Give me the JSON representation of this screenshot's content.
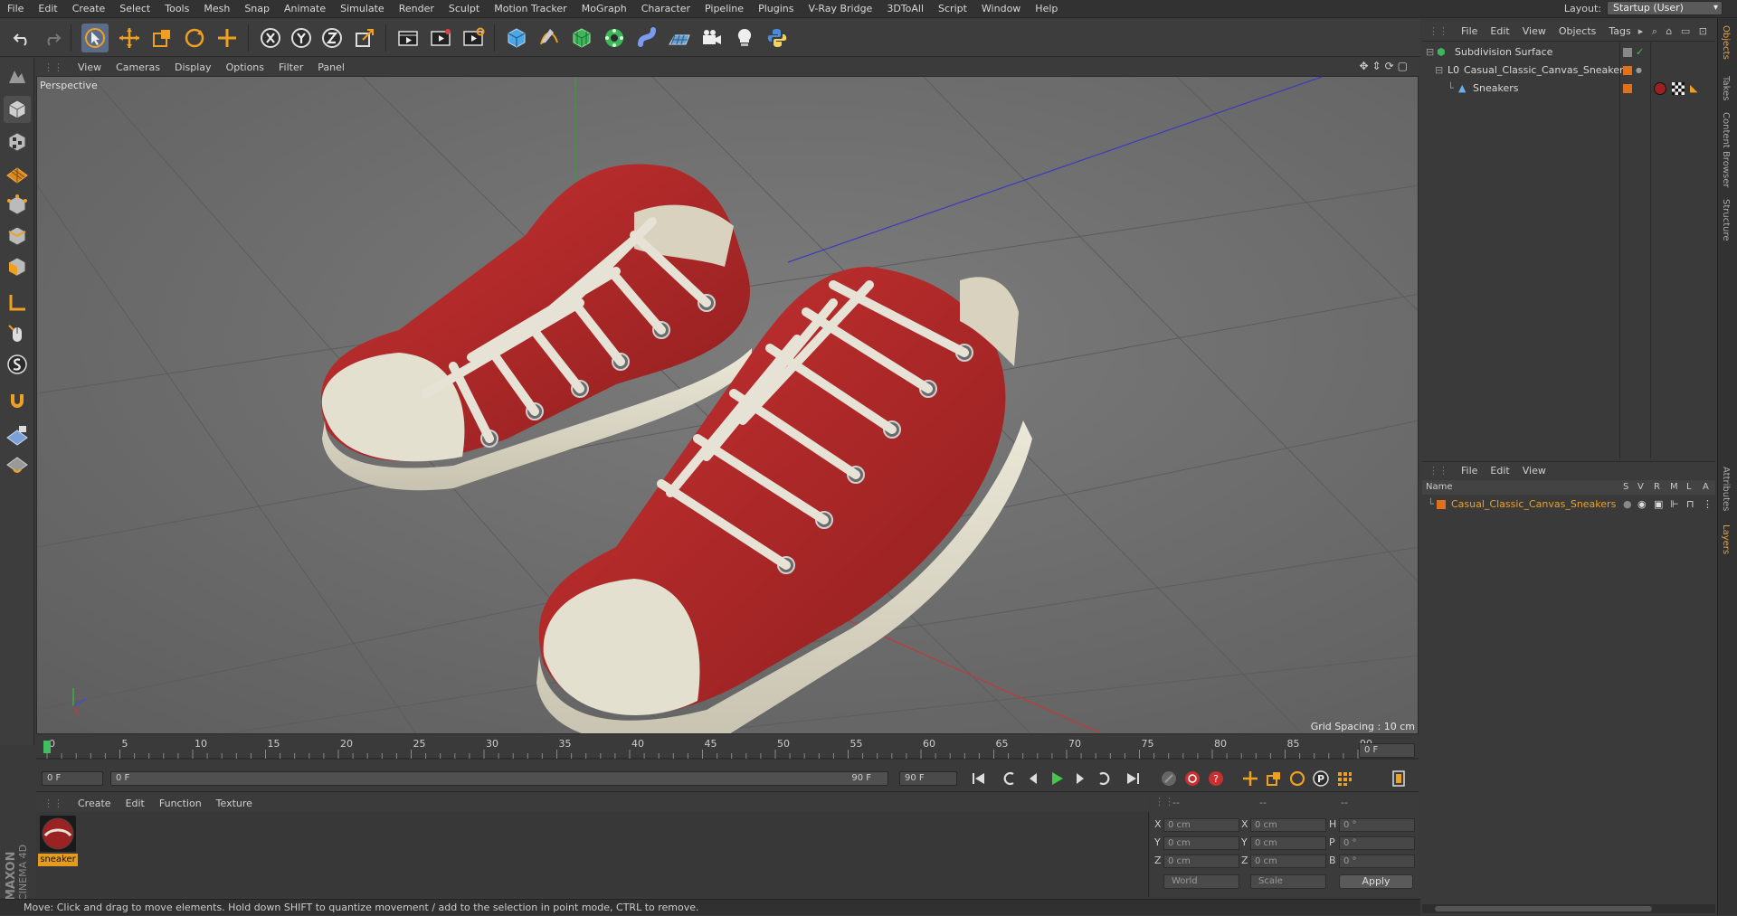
{
  "menubar": {
    "items": [
      "File",
      "Edit",
      "Create",
      "Select",
      "Tools",
      "Mesh",
      "Snap",
      "Animate",
      "Simulate",
      "Render",
      "Sculpt",
      "Motion Tracker",
      "MoGraph",
      "Character",
      "Pipeline",
      "Plugins",
      "V-Ray Bridge",
      "3DToAll",
      "Script",
      "Window",
      "Help"
    ],
    "layout_label": "Layout:",
    "layout_value": "Startup (User)"
  },
  "viewport": {
    "menu": [
      "View",
      "Cameras",
      "Display",
      "Options",
      "Filter",
      "Panel"
    ],
    "camera_label": "Perspective",
    "grid_spacing": "Grid Spacing : 10 cm"
  },
  "timeline": {
    "ticks": [
      "0",
      "5",
      "10",
      "15",
      "20",
      "25",
      "30",
      "35",
      "40",
      "45",
      "50",
      "55",
      "60",
      "65",
      "70",
      "75",
      "80",
      "85",
      "90"
    ],
    "current_frame_field": "0 F",
    "start_field": "0 F",
    "range_start": "0 F",
    "range_end": "90 F",
    "end_field": "90 F"
  },
  "material_panel": {
    "menu": [
      "Create",
      "Edit",
      "Function",
      "Texture"
    ],
    "material_name": "sneaker"
  },
  "coord_panel": {
    "headers": [
      "--",
      "--",
      "--"
    ],
    "rows": [
      {
        "l1": "X",
        "v1": "0 cm",
        "l2": "X",
        "v2": "0 cm",
        "l3": "H",
        "v3": "0 °"
      },
      {
        "l1": "Y",
        "v1": "0 cm",
        "l2": "Y",
        "v2": "0 cm",
        "l3": "P",
        "v3": "0 °"
      },
      {
        "l1": "Z",
        "v1": "0 cm",
        "l2": "Z",
        "v2": "0 cm",
        "l3": "B",
        "v3": "0 °"
      }
    ],
    "space": "World",
    "mode": "Scale",
    "apply": "Apply"
  },
  "object_manager": {
    "menu": [
      "File",
      "Edit",
      "View",
      "Objects",
      "Tags"
    ],
    "objects": [
      {
        "name": "Subdivision Surface"
      },
      {
        "name": "Casual_Classic_Canvas_Sneakers"
      },
      {
        "name": "Sneakers"
      }
    ]
  },
  "layer_manager": {
    "menu": [
      "File",
      "Edit",
      "View"
    ],
    "columns": {
      "name": "Name",
      "s": "S",
      "v": "V",
      "r": "R",
      "m": "M",
      "l": "L",
      "a": "A"
    },
    "layer_name": "Casual_Classic_Canvas_Sneakers"
  },
  "side_tabs": [
    "Objects",
    "Takes",
    "Content Browser",
    "Structure",
    "Attributes",
    "Layers"
  ],
  "brand": {
    "line1": "MAXON",
    "line2": "CINEMA 4D"
  },
  "status": "Move: Click and drag to move elements. Hold down SHIFT to quantize movement / add to the selection in point mode, CTRL to remove.",
  "colors": {
    "accent": "#5b6c88",
    "material_tag": "#e69b1c",
    "sneaker_red": "#b52a2a",
    "cream": "#e6e2d2"
  }
}
